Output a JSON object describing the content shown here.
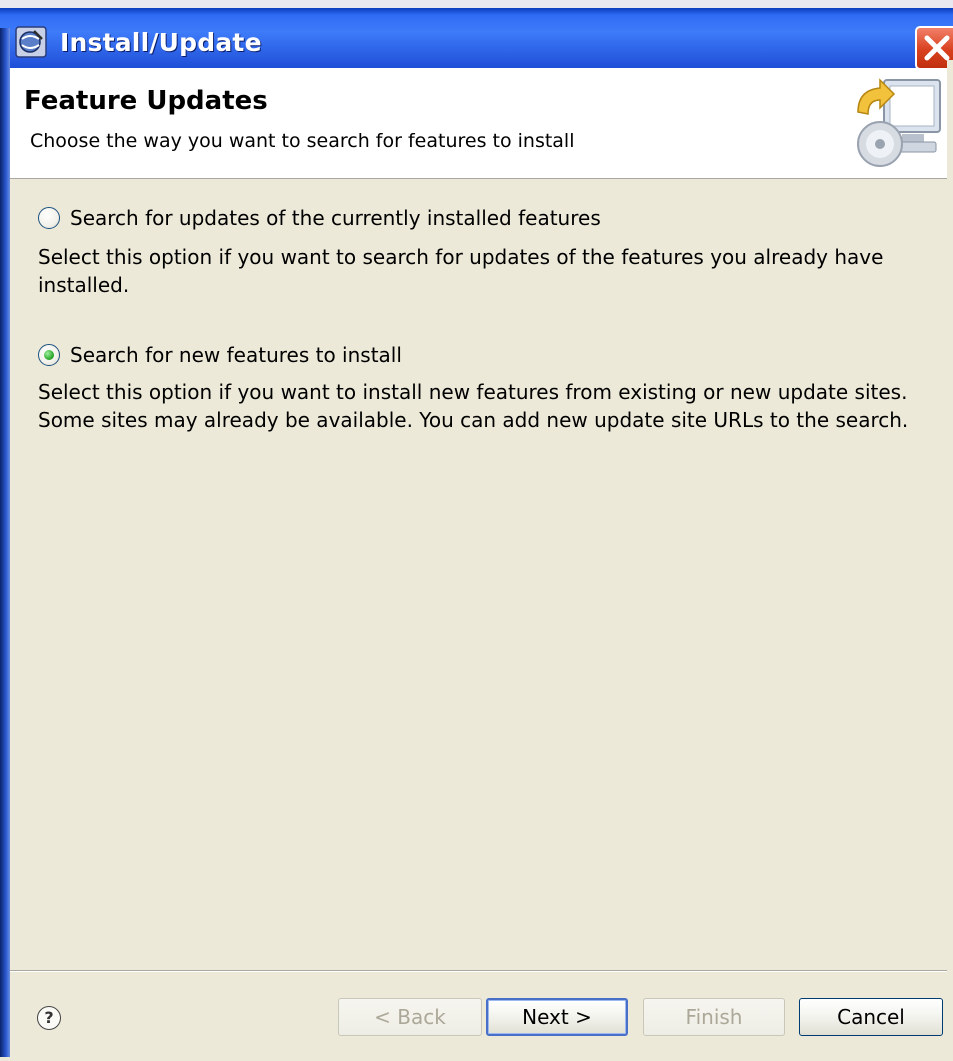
{
  "window": {
    "title": "Install/Update"
  },
  "header": {
    "title": "Feature Updates",
    "subtitle": "Choose the way you want to search for features to install"
  },
  "options": [
    {
      "label": "Search for updates of the currently installed features",
      "description": "Select this option if you want to search for updates of the features you already have installed.",
      "selected": false
    },
    {
      "label": "Search for new features to install",
      "description": "Select this option if you want to install new features from existing or new update sites. Some sites may already be available. You can add new update site URLs to the search.",
      "selected": true
    }
  ],
  "footer": {
    "help_symbol": "?",
    "back_label": "< Back",
    "next_label": "Next >",
    "finish_label": "Finish",
    "cancel_label": "Cancel"
  },
  "colors": {
    "titlebar": "#2f6cf5",
    "dialog_background": "#ece9d8",
    "radio_selected": "#21a121",
    "close_button": "#d9411e"
  }
}
